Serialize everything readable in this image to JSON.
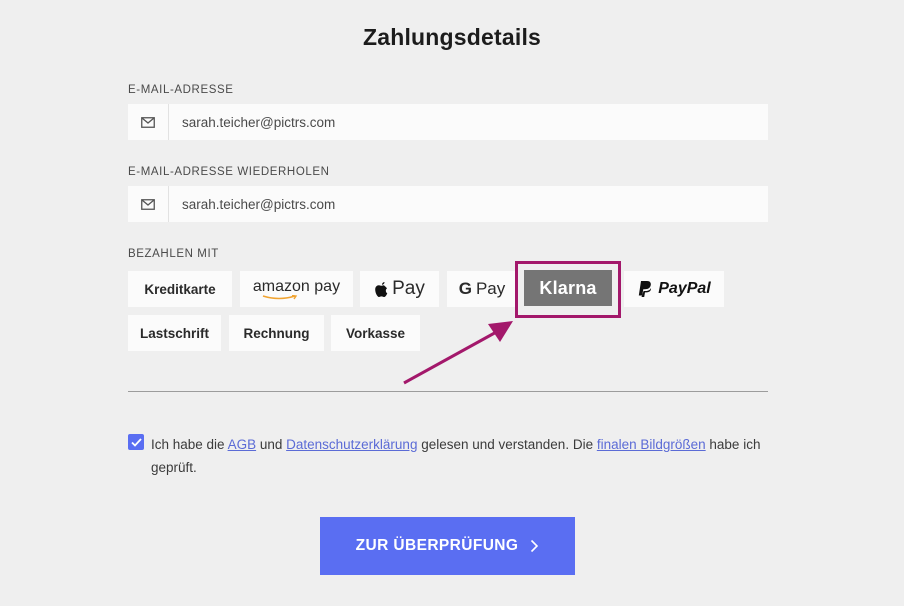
{
  "page": {
    "title": "Zahlungsdetails"
  },
  "email": {
    "label": "E-MAIL-ADRESSE",
    "value": "sarah.teicher@pictrs.com",
    "icon": "mail-icon"
  },
  "email_repeat": {
    "label": "E-MAIL-ADRESSE WIEDERHOLEN",
    "value": "sarah.teicher@pictrs.com",
    "icon": "mail-icon"
  },
  "payment": {
    "label": "BEZAHLEN MIT",
    "methods": {
      "kreditkarte": "Kreditkarte",
      "amazon_pay": "amazon pay",
      "apple_pay": "Pay",
      "google_pay": "Pay",
      "klarna": "Klarna",
      "paypal": "PayPal",
      "lastschrift": "Lastschrift",
      "rechnung": "Rechnung",
      "vorkasse": "Vorkasse"
    },
    "selected": "klarna",
    "highlight_color": "#a3186b"
  },
  "terms": {
    "checked": true,
    "text_1": "Ich habe die ",
    "link_agb": "AGB",
    "text_2": " und ",
    "link_privacy": "Datenschutzerklärung",
    "text_3": " gelesen und verstanden. Die ",
    "link_sizes": "finalen Bildgrößen",
    "text_4": " habe ich geprüft."
  },
  "cta": {
    "label": "ZUR ÜBERPRÜFUNG",
    "icon": "chevron-right-icon",
    "color": "#5a6ef2"
  }
}
